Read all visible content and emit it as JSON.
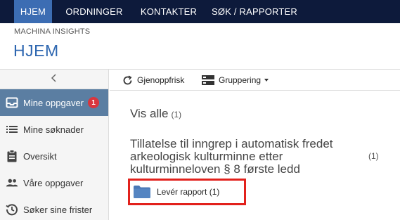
{
  "topnav": {
    "items": [
      {
        "label": "HJEM",
        "active": true
      },
      {
        "label": "ORDNINGER",
        "active": false
      },
      {
        "label": "KONTAKTER",
        "active": false
      },
      {
        "label": "SØK / RAPPORTER",
        "active": false
      }
    ]
  },
  "header": {
    "app_name": "MACHINA INSIGHTS",
    "title": "HJEM"
  },
  "sidebar": {
    "collapse_icon": "chevron-left-icon",
    "items": [
      {
        "label": "Mine oppgaver",
        "icon": "inbox-icon",
        "active": true,
        "badge": "1"
      },
      {
        "label": "Mine søknader",
        "icon": "list-icon",
        "active": false
      },
      {
        "label": "Oversikt",
        "icon": "clipboard-icon",
        "active": false
      },
      {
        "label": "Våre oppgaver",
        "icon": "people-icon",
        "active": false
      },
      {
        "label": "Søker sine frister",
        "icon": "clock-icon",
        "active": false
      }
    ]
  },
  "toolbar": {
    "refresh_label": "Gjenoppfrisk",
    "grouping_label": "Gruppering"
  },
  "main": {
    "vis_alle_label": "Vis alle",
    "vis_alle_count": "(1)",
    "group_title": "Tillatelse til inngrep i automatisk fredet arkeologisk kulturminne etter kulturminneloven § 8 første ledd",
    "group_count": "(1)",
    "folder_label": "Levér rapport (1)"
  },
  "colors": {
    "nav_bg": "#0d1a3b",
    "nav_active": "#3c6db3",
    "title_blue": "#2d66b0",
    "sidebar_active": "#5b7ea2",
    "badge_red": "#d9363e",
    "highlight_red": "#e2211c",
    "folder_blue": "#4a78b5"
  }
}
